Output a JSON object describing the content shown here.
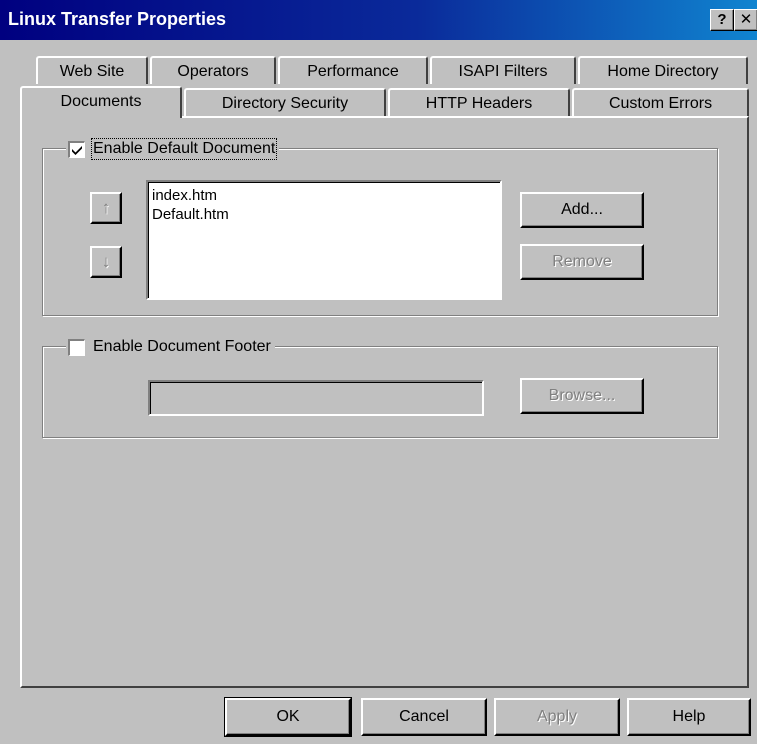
{
  "window": {
    "title": "Linux Transfer Properties",
    "help_glyph": "?",
    "close_glyph": "✕"
  },
  "tabs_row1": [
    "Web Site",
    "Operators",
    "Performance",
    "ISAPI Filters",
    "Home Directory"
  ],
  "tabs_row2": [
    "Documents",
    "Directory Security",
    "HTTP Headers",
    "Custom Errors"
  ],
  "active_tab": "Documents",
  "default_document": {
    "enabled": true,
    "label": "Enable Default Document",
    "list": [
      "index.htm",
      "Default.htm"
    ],
    "move_up_icon": "arrow-up-icon",
    "move_down_icon": "arrow-down-icon",
    "add_label": "Add...",
    "remove_label": "Remove"
  },
  "document_footer": {
    "enabled": false,
    "label": "Enable Document Footer",
    "path_value": "",
    "browse_label": "Browse..."
  },
  "buttons": {
    "ok": "OK",
    "cancel": "Cancel",
    "apply": "Apply",
    "help": "Help"
  }
}
